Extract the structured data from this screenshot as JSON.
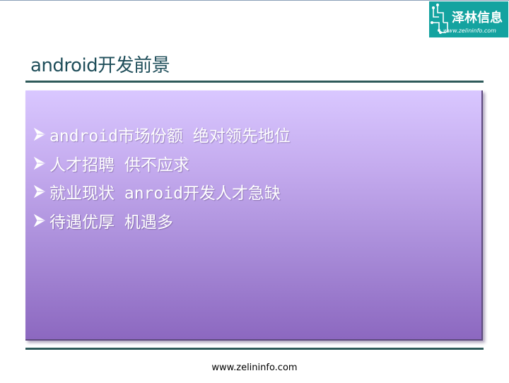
{
  "logo": {
    "name": "泽林信息",
    "url": "www.zelininfo.com"
  },
  "slide": {
    "title": "android开发前景",
    "bullets": [
      {
        "icon": "arrow-bullet-icon",
        "text": "android市场份额 绝对领先地位"
      },
      {
        "icon": "arrow-bullet-icon",
        "text": "人才招聘 供不应求"
      },
      {
        "icon": "arrow-bullet-icon",
        "text": "就业现状 anroid开发人才急缺"
      },
      {
        "icon": "arrow-bullet-icon",
        "text": "待遇优厚 机遇多"
      }
    ]
  },
  "footer": {
    "url": "www.zelininfo.com"
  },
  "colors": {
    "title": "#1f4e5a",
    "rule": "#2e5a5a",
    "logo_bg": "#14a3a0",
    "box_top": "#d9c7ff",
    "box_bottom": "#8c68c0",
    "bullet_text": "#ffffff"
  }
}
